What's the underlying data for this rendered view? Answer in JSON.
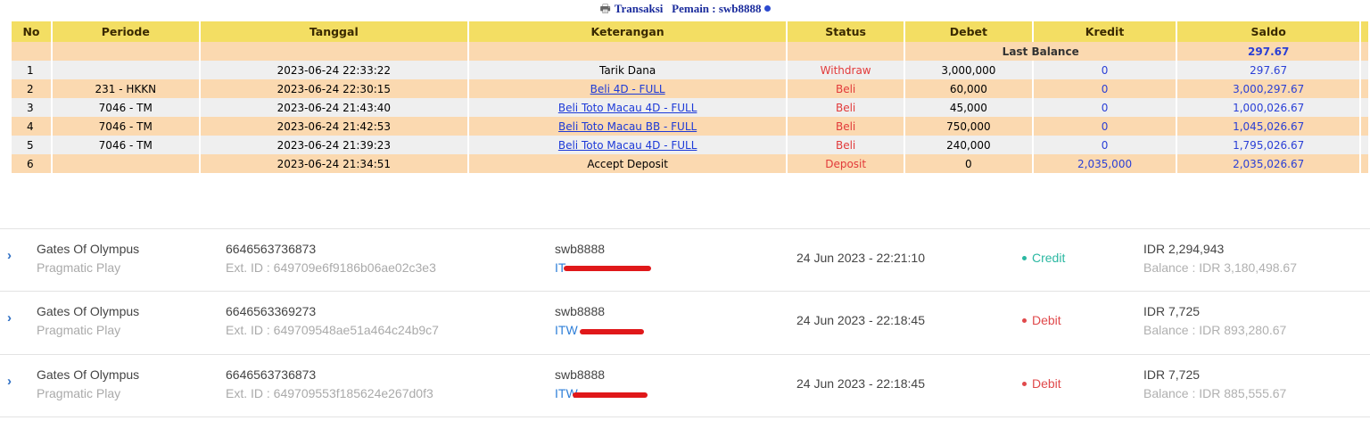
{
  "header": {
    "title": "Transaksi   Pemain : swb8888",
    "icon": "printer-icon"
  },
  "columns": [
    "No",
    "Periode",
    "Tanggal",
    "Keterangan",
    "Status",
    "Debet",
    "Kredit",
    "Saldo"
  ],
  "last_balance": {
    "label": "Last Balance",
    "value": "297.67"
  },
  "rows": [
    {
      "no": "1",
      "periode": "",
      "tanggal": "2023-06-24 22:33:22",
      "keterangan": "Tarik Dana",
      "link": false,
      "status": "Withdraw",
      "debet": "3,000,000",
      "kredit": "0",
      "saldo": "297.67"
    },
    {
      "no": "2",
      "periode": "231 - HKKN",
      "tanggal": "2023-06-24 22:30:15",
      "keterangan": "Beli 4D - FULL",
      "link": true,
      "status": "Beli",
      "debet": "60,000",
      "kredit": "0",
      "saldo": "3,000,297.67"
    },
    {
      "no": "3",
      "periode": "7046 - TM",
      "tanggal": "2023-06-24 21:43:40",
      "keterangan": "Beli Toto Macau 4D - FULL",
      "link": true,
      "status": "Beli",
      "debet": "45,000",
      "kredit": "0",
      "saldo": "1,000,026.67"
    },
    {
      "no": "4",
      "periode": "7046 - TM",
      "tanggal": "2023-06-24 21:42:53",
      "keterangan": "Beli Toto Macau BB - FULL",
      "link": true,
      "status": "Beli",
      "debet": "750,000",
      "kredit": "0",
      "saldo": "1,045,026.67"
    },
    {
      "no": "5",
      "periode": "7046 - TM",
      "tanggal": "2023-06-24 21:39:23",
      "keterangan": "Beli Toto Macau 4D - FULL",
      "link": true,
      "status": "Beli",
      "debet": "240,000",
      "kredit": "0",
      "saldo": "1,795,026.67"
    },
    {
      "no": "6",
      "periode": "",
      "tanggal": "2023-06-24 21:34:51",
      "keterangan": "Accept Deposit",
      "link": false,
      "status": "Deposit",
      "debet": "0",
      "kredit": "2,035,000",
      "saldo": "2,035,026.67"
    }
  ],
  "games": [
    {
      "game": "Gates Of Olympus",
      "provider": "Pragmatic Play",
      "tx_id": "6646563736873",
      "ext_id": "Ext. ID : 649709e6f9186b06ae02c3e3",
      "user": "swb8888",
      "user_code": "IT",
      "date": "24 Jun 2023 - 22:21:10",
      "status": "Credit",
      "amount": "IDR 2,294,943",
      "balance": "Balance : IDR 3,180,498.67"
    },
    {
      "game": "Gates Of Olympus",
      "provider": "Pragmatic Play",
      "tx_id": "6646563369273",
      "ext_id": "Ext. ID : 649709548ae51a464c24b9c7",
      "user": "swb8888",
      "user_code": "ITW",
      "date": "24 Jun 2023 - 22:18:45",
      "status": "Debit",
      "amount": "IDR 7,725",
      "balance": "Balance : IDR 893,280.67"
    },
    {
      "game": "Gates Of Olympus",
      "provider": "Pragmatic Play",
      "tx_id": "6646563736873",
      "ext_id": "Ext. ID : 649709553f185624e267d0f3",
      "user": "swb8888",
      "user_code": "ITW",
      "date": "24 Jun 2023 - 22:18:45",
      "status": "Debit",
      "amount": "IDR 7,725",
      "balance": "Balance : IDR 885,555.67"
    }
  ],
  "colors": {
    "header_bg": "#f3de63",
    "row_even": "#fbd9b0",
    "row_odd": "#efefef",
    "status_red": "#e23a3a",
    "link_blue": "#1d3ad8",
    "credit": "#2bb8a2",
    "debit": "#e0494b"
  }
}
